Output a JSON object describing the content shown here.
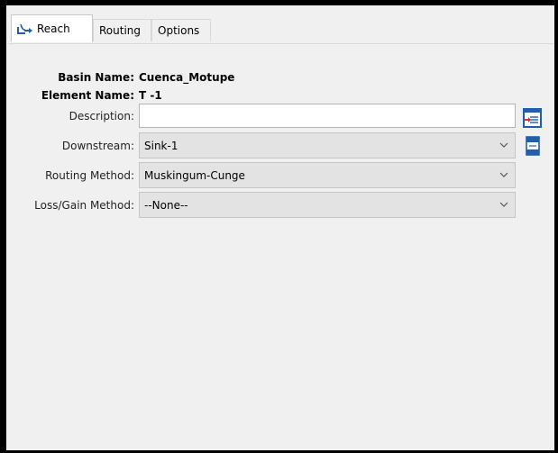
{
  "tabs": [
    {
      "label": "Reach",
      "icon": "reach-icon",
      "active": true
    },
    {
      "label": "Routing",
      "active": false
    },
    {
      "label": "Options",
      "active": false
    }
  ],
  "info": {
    "basin_label": "Basin Name:",
    "basin_value": "Cuenca_Motupe",
    "element_label": "Element Name:",
    "element_value": "T -1"
  },
  "form": {
    "description_label": "Description:",
    "description_value": "",
    "downstream_label": "Downstream:",
    "downstream_value": "Sink-1",
    "routing_label": "Routing Method:",
    "routing_value": "Muskingum-Cunge",
    "lossgain_label": "Loss/Gain Method:",
    "lossgain_value": "--None--"
  },
  "icons": {
    "description_button": "edit-description-icon",
    "downstream_button": "select-downstream-icon"
  },
  "colors": {
    "panel": "#f0f0f0",
    "select_bg": "#e3e3e3",
    "accent": "#1f5fae"
  }
}
